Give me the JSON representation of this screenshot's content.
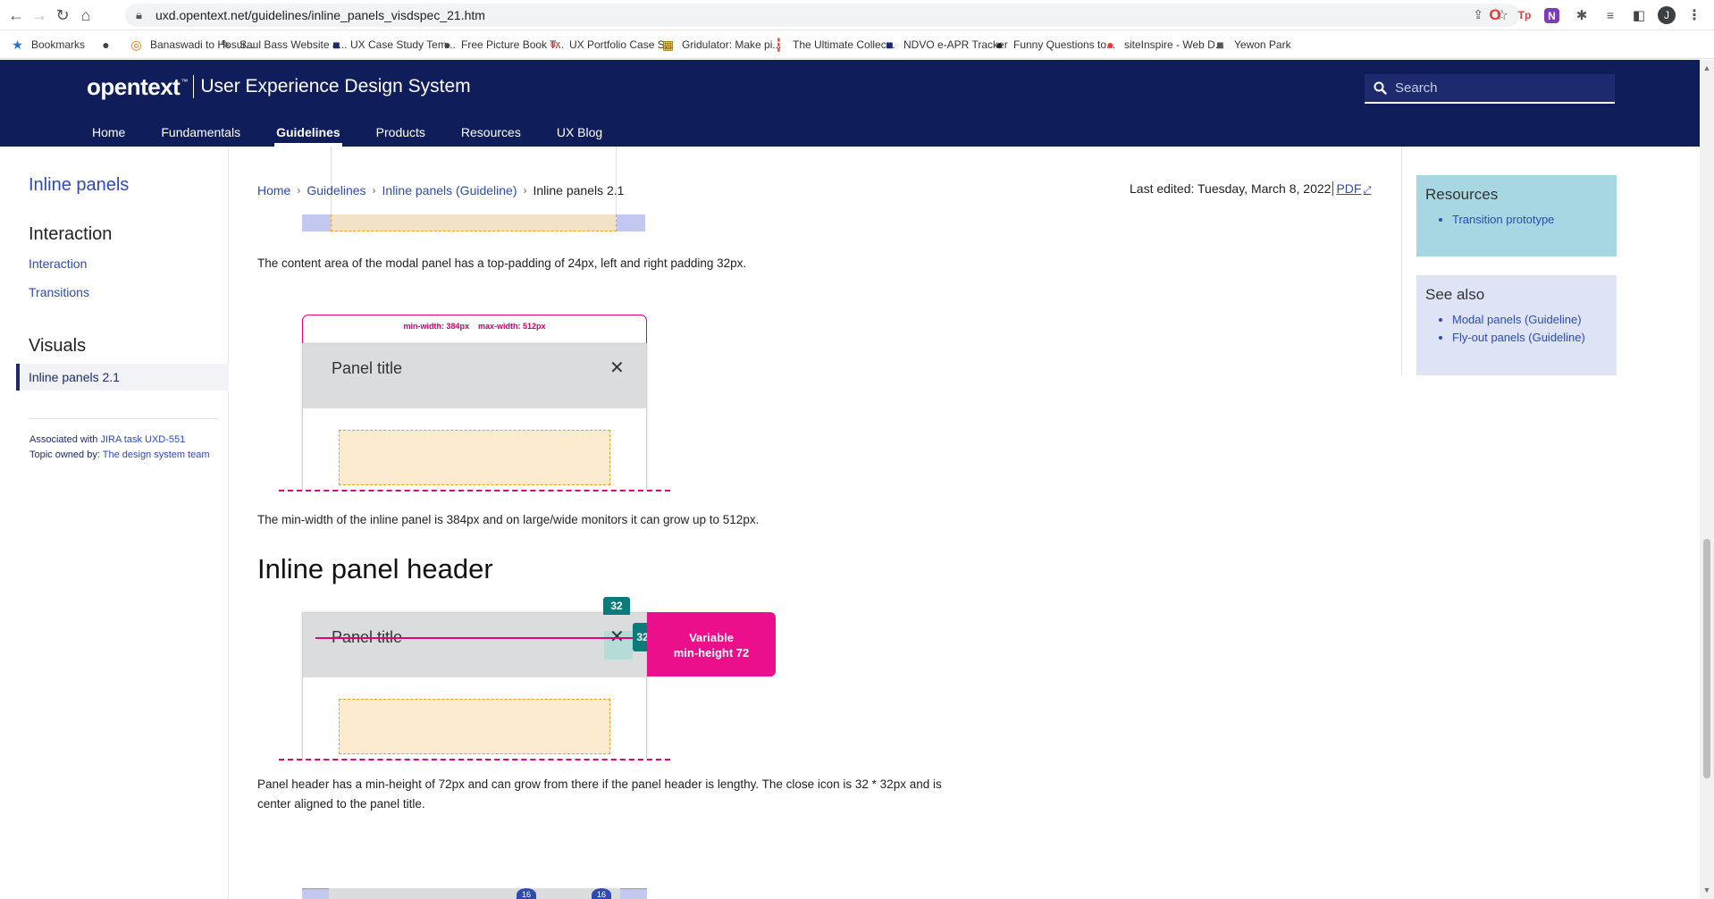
{
  "browser": {
    "url": "uxd.opentext.net/guidelines/inline_panels_visdspec_21.htm",
    "profile_initial": "J",
    "bookmarks": [
      {
        "label": "Bookmarks",
        "icon": "star-icon",
        "color": "#1a73e8"
      },
      {
        "label": "",
        "icon": "globe-icon",
        "color": "#444444"
      },
      {
        "label": "Banaswadi to Hosur...",
        "icon": "route-icon",
        "color": "#e37400"
      },
      {
        "label": "Saul Bass Website a...",
        "icon": "pin-icon",
        "color": "#333333"
      },
      {
        "label": "UX Case Study Tem...",
        "icon": "square-icon",
        "color": "#1d2b6e"
      },
      {
        "label": "Free Picture Book T...",
        "icon": "globe-icon",
        "color": "#444444"
      },
      {
        "label": "UX Portfolio Case S...",
        "icon": "ux-icon",
        "color": "#e53935"
      },
      {
        "label": "Gridulator: Make pi...",
        "icon": "grid-icon",
        "color": "#8d6e00"
      },
      {
        "label": "The Ultimate Collec...",
        "icon": "bars-icon",
        "color": "#e53935"
      },
      {
        "label": "NDVO e-APR Tracker",
        "icon": "square-icon",
        "color": "#1d2b6e"
      },
      {
        "label": "Funny Questions to...",
        "icon": "globe-icon",
        "color": "#222222"
      },
      {
        "label": "siteInspire - Web D...",
        "icon": "circle-icon",
        "color": "#e53935"
      },
      {
        "label": "Yewon Park",
        "icon": "square-icon",
        "color": "#555555"
      }
    ]
  },
  "site": {
    "brand": "opentext",
    "brand_tm": "™",
    "tagline": "User Experience Design System",
    "search_placeholder": "Search",
    "nav": [
      {
        "label": "Home",
        "active": false
      },
      {
        "label": "Fundamentals",
        "active": false
      },
      {
        "label": "Guidelines",
        "active": true
      },
      {
        "label": "Products",
        "active": false
      },
      {
        "label": "Resources",
        "active": false
      },
      {
        "label": "UX Blog",
        "active": false
      }
    ]
  },
  "sidebar": {
    "title": "Inline panels",
    "group_interaction": "Interaction",
    "link_interaction": "Interaction",
    "link_transitions": "Transitions",
    "group_visuals": "Visuals",
    "link_active": "Inline panels 2.1",
    "meta_line1_prefix": "Associated with ",
    "meta_line1_link": "JIRA task UXD-551",
    "meta_line2_prefix": "Topic owned by: ",
    "meta_line2_link": "The design system team"
  },
  "breadcrumb": {
    "items": [
      "Home",
      "Guidelines",
      "Inline panels (Guideline)"
    ],
    "current": "Inline panels 2.1"
  },
  "meta": {
    "last_edited": "Last edited: Tuesday, March 8, 2022",
    "pdf": "PDF"
  },
  "content": {
    "para_padding": "The content area of the modal panel has a top-padding of 24px, left and right padding 32px.",
    "para_minwidth": "The min-width of the inline panel is 384px and on large/wide monitors it can grow up to 512px.",
    "heading_header": "Inline panel header",
    "para_header_line1": "Panel header has a min-height of 72px and can grow from there if the panel header is lengthy. The close icon is 32 * 32px and is",
    "para_header_line2": "center aligned to the panel title."
  },
  "diagram1": {
    "min_width_label": "min-width: 384px",
    "max_width_label": "max-width: 512px",
    "panel_title": "Panel title",
    "close_glyph": "✕"
  },
  "diagram2": {
    "panel_title": "Panel title",
    "close_glyph": "✕",
    "badge_top": "32",
    "badge_right": "32",
    "callout_line1": "Variable",
    "callout_line2": "min-height 72"
  },
  "diagram3": {
    "badge_a": "16",
    "badge_b": "16"
  },
  "rail": {
    "resources_title": "Resources",
    "resources_items": [
      "Transition prototype"
    ],
    "seealso_title": "See also",
    "seealso_items": [
      "Modal panels (Guideline)",
      "Fly-out panels (Guideline)"
    ]
  },
  "colors": {
    "header_bg": "#0f1d5b",
    "link": "#2d4bb3",
    "magenta": "#e0007a",
    "teal": "#0b7a7a",
    "content_fill": "#fdebd0",
    "panel_header_grey": "#dadcde"
  }
}
